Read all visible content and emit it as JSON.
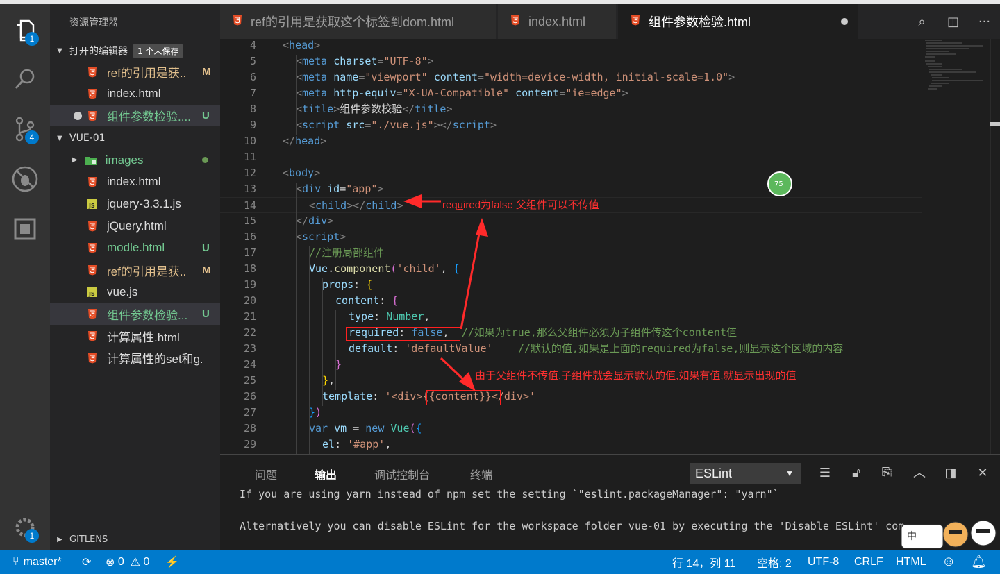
{
  "sidebar": {
    "title": "资源管理器",
    "open_editors": {
      "label": "打开的编辑器",
      "badge": "1 个未保存"
    },
    "open_files": [
      {
        "name": "ref的引用是获..",
        "status": "M",
        "icon": "html5-icon",
        "dirty": false,
        "selected": false
      },
      {
        "name": "index.html",
        "status": "",
        "icon": "html5-icon",
        "dirty": false,
        "selected": false
      },
      {
        "name": "组件参数检验....",
        "status": "U",
        "icon": "html5-icon",
        "dirty": true,
        "selected": true
      }
    ],
    "project": {
      "label": "VUE-01"
    },
    "files": [
      {
        "name": "images",
        "status": "dot",
        "icon": "folder-images-icon",
        "folder": true
      },
      {
        "name": "index.html",
        "status": "",
        "icon": "html5-icon"
      },
      {
        "name": "jquery-3.3.1.js",
        "status": "",
        "icon": "js-icon"
      },
      {
        "name": "jQuery.html",
        "status": "",
        "icon": "html5-icon"
      },
      {
        "name": "modle.html",
        "status": "U",
        "icon": "html5-icon"
      },
      {
        "name": "ref的引用是获..",
        "status": "M",
        "icon": "html5-icon"
      },
      {
        "name": "vue.js",
        "status": "",
        "icon": "js-icon"
      },
      {
        "name": "组件参数检验...",
        "status": "U",
        "icon": "html5-icon",
        "selected": true
      },
      {
        "name": "计算属性.html",
        "status": "",
        "icon": "html5-icon"
      },
      {
        "name": "计算属性的set和g...",
        "status": "",
        "icon": "html5-icon"
      }
    ],
    "gitlens": "GITLENS"
  },
  "activity": {
    "explorer_badge": "1",
    "scm_badge": "4",
    "settings_badge": "1"
  },
  "tabs": [
    {
      "label": "ref的引用是获取这个标签到dom.html",
      "active": false
    },
    {
      "label": "index.html",
      "active": false
    },
    {
      "label": "组件参数检验.html",
      "active": true,
      "dirty": true
    }
  ],
  "editor": {
    "lines": [
      {
        "n": "4",
        "t": [
          [
            "t-br",
            "<"
          ],
          [
            "t-tag",
            "head"
          ],
          [
            "t-br",
            ">"
          ]
        ]
      },
      {
        "n": "5",
        "t": [
          [
            "t-br",
            "<"
          ],
          [
            "t-tag",
            "meta "
          ],
          [
            "t-attr",
            "charset"
          ],
          [
            "t-txt",
            "="
          ],
          [
            "t-str",
            "\"UTF-8\""
          ],
          [
            "t-br",
            ">"
          ]
        ]
      },
      {
        "n": "6",
        "t": [
          [
            "t-br",
            "<"
          ],
          [
            "t-tag",
            "meta "
          ],
          [
            "t-attr",
            "name"
          ],
          [
            "t-txt",
            "="
          ],
          [
            "t-str",
            "\"viewport\" "
          ],
          [
            "t-attr",
            "content"
          ],
          [
            "t-txt",
            "="
          ],
          [
            "t-str",
            "\"width=device-width, initial-scale=1.0\""
          ],
          [
            "t-br",
            ">"
          ]
        ]
      },
      {
        "n": "7",
        "t": [
          [
            "t-br",
            "<"
          ],
          [
            "t-tag",
            "meta "
          ],
          [
            "t-attr",
            "http-equiv"
          ],
          [
            "t-txt",
            "="
          ],
          [
            "t-str",
            "\"X-UA-Compatible\" "
          ],
          [
            "t-attr",
            "content"
          ],
          [
            "t-txt",
            "="
          ],
          [
            "t-str",
            "\"ie=edge\""
          ],
          [
            "t-br",
            ">"
          ]
        ]
      },
      {
        "n": "8",
        "t": [
          [
            "t-br",
            "<"
          ],
          [
            "t-tag",
            "title"
          ],
          [
            "t-br",
            ">"
          ],
          [
            "t-txt",
            "组件参数校验"
          ],
          [
            "t-br",
            "</"
          ],
          [
            "t-tag",
            "title"
          ],
          [
            "t-br",
            ">"
          ]
        ]
      },
      {
        "n": "9",
        "t": [
          [
            "t-br",
            "<"
          ],
          [
            "t-tag",
            "script "
          ],
          [
            "t-attr",
            "src"
          ],
          [
            "t-txt",
            "="
          ],
          [
            "t-str",
            "\"./vue.js\""
          ],
          [
            "t-br",
            "></"
          ],
          [
            "t-tag",
            "script"
          ],
          [
            "t-br",
            ">"
          ]
        ]
      },
      {
        "n": "10",
        "t": [
          [
            "t-br",
            "</"
          ],
          [
            "t-tag",
            "head"
          ],
          [
            "t-br",
            ">"
          ]
        ]
      },
      {
        "n": "11",
        "t": []
      },
      {
        "n": "12",
        "t": [
          [
            "t-br",
            "<"
          ],
          [
            "t-tag",
            "body"
          ],
          [
            "t-br",
            ">"
          ]
        ]
      },
      {
        "n": "13",
        "t": [
          [
            "t-br",
            "<"
          ],
          [
            "t-tag",
            "div "
          ],
          [
            "t-attr",
            "id"
          ],
          [
            "t-txt",
            "="
          ],
          [
            "t-str",
            "\"app\""
          ],
          [
            "t-br",
            ">"
          ]
        ]
      },
      {
        "n": "14",
        "t": [
          [
            "t-br",
            "<"
          ],
          [
            "t-tag",
            "child"
          ],
          [
            "t-br",
            "></"
          ],
          [
            "t-tag",
            "child"
          ],
          [
            "t-br",
            ">"
          ]
        ]
      },
      {
        "n": "15",
        "t": [
          [
            "t-br",
            "</"
          ],
          [
            "t-tag",
            "div"
          ],
          [
            "t-br",
            ">"
          ]
        ]
      },
      {
        "n": "16",
        "t": [
          [
            "t-br",
            "<"
          ],
          [
            "t-tag",
            "script"
          ],
          [
            "t-br",
            ">"
          ]
        ]
      },
      {
        "n": "17",
        "t": [
          [
            "t-com",
            "//注册局部组件"
          ]
        ]
      },
      {
        "n": "18",
        "t": [
          [
            "t-attr",
            "Vue"
          ],
          [
            "t-txt",
            "."
          ],
          [
            "t-fn",
            "component"
          ],
          [
            "t-b2",
            "("
          ],
          [
            "t-str",
            "'child'"
          ],
          [
            "t-txt",
            ", "
          ],
          [
            "t-b3",
            "{"
          ]
        ]
      },
      {
        "n": "19",
        "t": [
          [
            "t-attr",
            "props"
          ],
          [
            "t-txt",
            ": "
          ],
          [
            "t-b1",
            "{"
          ]
        ]
      },
      {
        "n": "20",
        "t": [
          [
            "t-attr",
            "content"
          ],
          [
            "t-txt",
            ": "
          ],
          [
            "t-b2",
            "{"
          ]
        ]
      },
      {
        "n": "21",
        "t": [
          [
            "t-attr",
            "type"
          ],
          [
            "t-txt",
            ": "
          ],
          [
            "t-cls",
            "Number"
          ],
          [
            "t-txt",
            ","
          ]
        ]
      },
      {
        "n": "22",
        "t": [
          [
            "t-attr",
            "required"
          ],
          [
            "t-txt",
            ": "
          ],
          [
            "t-kw",
            "false"
          ],
          [
            "t-txt",
            ",  "
          ],
          [
            "t-com",
            "//如果为true,那么父组件必须为子组件传这个content值"
          ]
        ]
      },
      {
        "n": "23",
        "t": [
          [
            "t-attr",
            "default"
          ],
          [
            "t-txt",
            ": "
          ],
          [
            "t-str",
            "'defaultValue'"
          ],
          [
            "t-txt",
            "    "
          ],
          [
            "t-com",
            "//默认的值,如果是上面的required为false,则显示这个区域的内容"
          ]
        ]
      },
      {
        "n": "24",
        "t": [
          [
            "t-b2",
            "}"
          ]
        ]
      },
      {
        "n": "25",
        "t": [
          [
            "t-b1",
            "}"
          ],
          [
            "t-txt",
            ","
          ]
        ]
      },
      {
        "n": "26",
        "t": [
          [
            "t-attr",
            "template"
          ],
          [
            "t-txt",
            ": "
          ],
          [
            "t-str",
            "'<div>{{content}}</div>'"
          ]
        ]
      },
      {
        "n": "27",
        "t": [
          [
            "t-b3",
            "}"
          ],
          [
            "t-b2",
            ")"
          ]
        ]
      },
      {
        "n": "28",
        "t": [
          [
            "t-kw",
            "var "
          ],
          [
            "t-attr",
            "vm"
          ],
          [
            "t-txt",
            " = "
          ],
          [
            "t-kw",
            "new "
          ],
          [
            "t-cls",
            "Vue"
          ],
          [
            "t-b2",
            "("
          ],
          [
            "t-b3",
            "{"
          ]
        ]
      },
      {
        "n": "29",
        "t": [
          [
            "t-attr",
            "el"
          ],
          [
            "t-txt",
            ": "
          ],
          [
            "t-str",
            "'#app'"
          ],
          [
            "t-txt",
            ","
          ]
        ]
      }
    ],
    "annotations": {
      "required_note": "requ̲ired为false 父组件可以不传值",
      "default_note": "由于父组件不传值,子组件就会显示默认的值,如果有值,就显示出现的值"
    },
    "badge_value": "75"
  },
  "panel": {
    "tabs": [
      "问题",
      "输出",
      "调试控制台",
      "终端"
    ],
    "active_tab": "输出",
    "select_value": "ESLint",
    "output": [
      "If you are using yarn instead of npm set the setting `\"eslint.packageManager\": \"yarn\"`",
      "",
      "Alternatively you can disable ESLint for the workspace folder vue-01 by executing the 'Disable ESLint' com"
    ]
  },
  "status": {
    "branch": "master*",
    "errors": "0",
    "warnings": "0",
    "position": "行 14，列 11",
    "spaces": "空格: 2",
    "encoding": "UTF-8",
    "eol": "CRLF",
    "language": "HTML"
  },
  "sticker_text": "中"
}
